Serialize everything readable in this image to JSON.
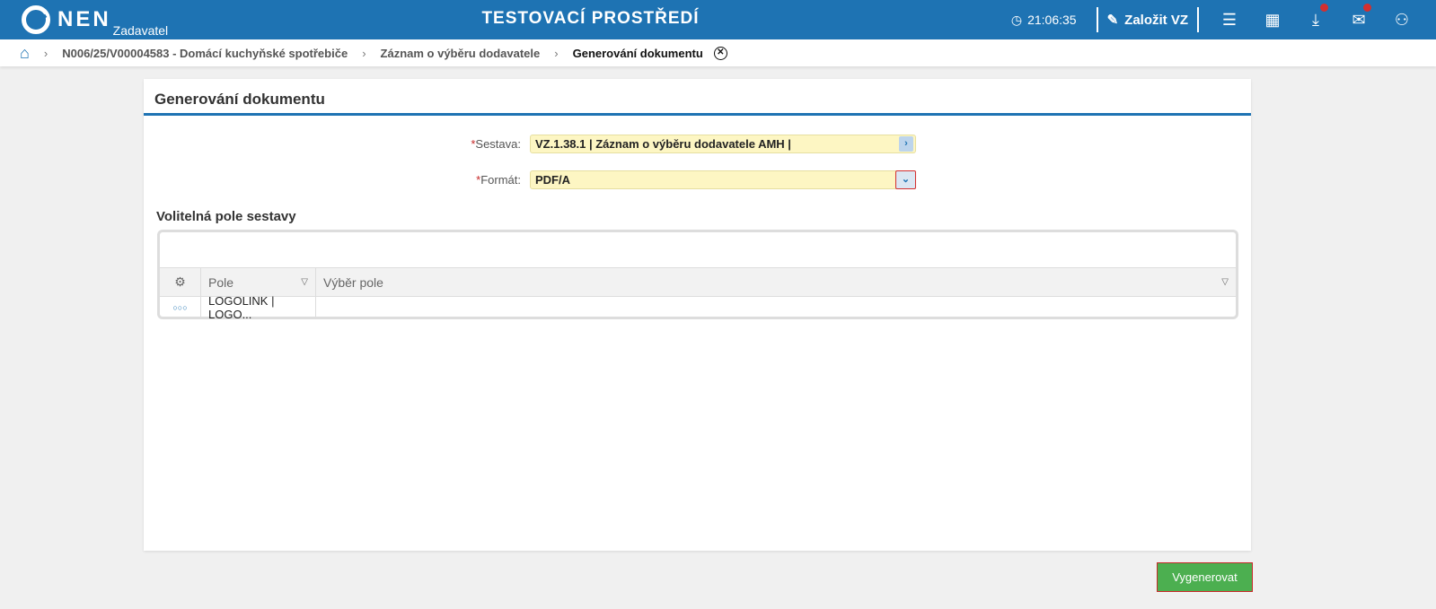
{
  "header": {
    "logo": "NEN",
    "role": "Zadavatel",
    "environment": "TESTOVACÍ PROSTŘEDÍ",
    "time": "21:06:35",
    "create_label": "Založit VZ",
    "icons": [
      "clock-icon",
      "edit-icon",
      "menu-icon",
      "calendar-icon",
      "download-icon",
      "mail-icon",
      "user-icon"
    ]
  },
  "breadcrumb": {
    "items": [
      "N006/25/V00004583 - Domácí kuchyňské spotřebiče",
      "Záznam o výběru dodavatele",
      "Generování dokumentu"
    ]
  },
  "panel": {
    "title": "Generování dokumentu",
    "fields": [
      {
        "label": "Sestava:",
        "value": "VZ.1.38.1 | Záznam o výběru dodavatele AMH |"
      },
      {
        "label": "Formát:",
        "value": "PDF/A"
      }
    ],
    "section_title": "Volitelná pole sestavy",
    "grid": {
      "columns": [
        "Pole",
        "Výběr pole"
      ],
      "rows": [
        {
          "pole": "LOGOLINK | LOGO...",
          "vyber": ""
        }
      ]
    }
  },
  "actions": {
    "generate": "Vygenerovat"
  },
  "colors": {
    "brand": "#1e73b3",
    "button": "#4caf50",
    "input": "#fdf6c3"
  }
}
